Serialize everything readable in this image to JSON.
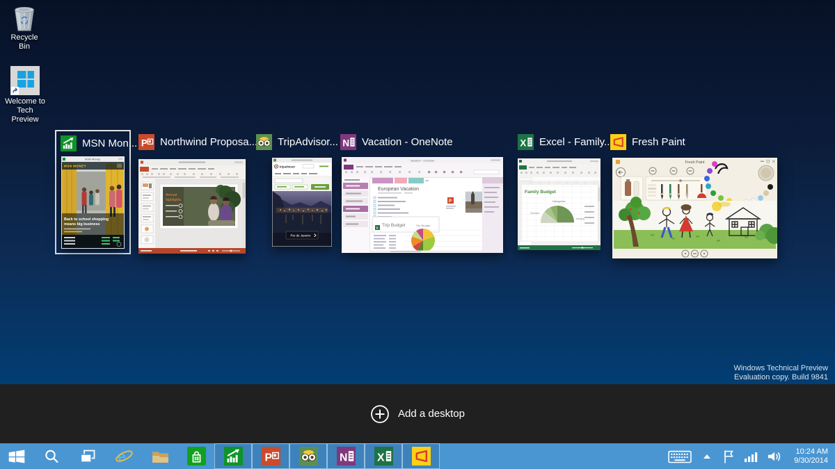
{
  "desktop": {
    "icons": [
      {
        "label": "Recycle Bin"
      },
      {
        "label_line1": "Welcome to",
        "label_line2": "Tech Preview"
      }
    ],
    "watermark": {
      "line1": "Windows Technical Preview",
      "line2": "Evaluation copy. Build 9841"
    }
  },
  "task_view": {
    "add_desktop_label": "Add a desktop",
    "windows": [
      {
        "title": "MSN Mon...",
        "app": "MSN Money",
        "selected": true,
        "thumb": {
          "titlebar": "MSN Money",
          "brand": "MSN MONEY",
          "headline_line1": "Back to school shopping",
          "headline_line2": "means big business"
        }
      },
      {
        "title": "Northwind Proposa...",
        "app": "PowerPoint",
        "thumb": {
          "heading_line1": "Annual",
          "heading_line2": "highlights."
        }
      },
      {
        "title": "TripAdvisor...",
        "app": "TripAdvisor",
        "thumb": {
          "logo": "tripadvisor",
          "location_button": "Rio de Janeiro"
        }
      },
      {
        "title": "Vacation - OneNote",
        "app": "OneNote",
        "thumb": {
          "titlebar": "Vacation - OneNote",
          "page_title": "European Vacation",
          "budget_box": "Trip Budget",
          "chart_title": "Trip Budget"
        }
      },
      {
        "title": "Excel - Family...",
        "app": "Excel",
        "thumb": {
          "sheet_title": "Family Budget",
          "chart_title": "Categories",
          "label_left": "Donation",
          "label_right": "Housing"
        }
      },
      {
        "title": "Fresh Paint",
        "app": "Fresh Paint",
        "thumb": {
          "titlebar": "Fresh Paint"
        }
      }
    ]
  },
  "taskbar": {
    "pinned": [
      "Start",
      "Search",
      "Task View",
      "Internet Explorer",
      "File Explorer",
      "Store"
    ],
    "running": [
      "MSN Money",
      "PowerPoint",
      "TripAdvisor",
      "OneNote",
      "Excel",
      "Fresh Paint"
    ],
    "tray_icons": [
      "keyboard",
      "show-hidden",
      "action-center-flag",
      "network",
      "volume"
    ],
    "tray": {
      "time": "10:24 AM",
      "date": "9/30/2014"
    }
  },
  "colors": {
    "taskbar": "#4a96d3",
    "task_view_band": "#202020",
    "desktop_top": "#071126",
    "desktop_bottom": "#004a80",
    "selected_tile_border": "#dfe3e6"
  }
}
